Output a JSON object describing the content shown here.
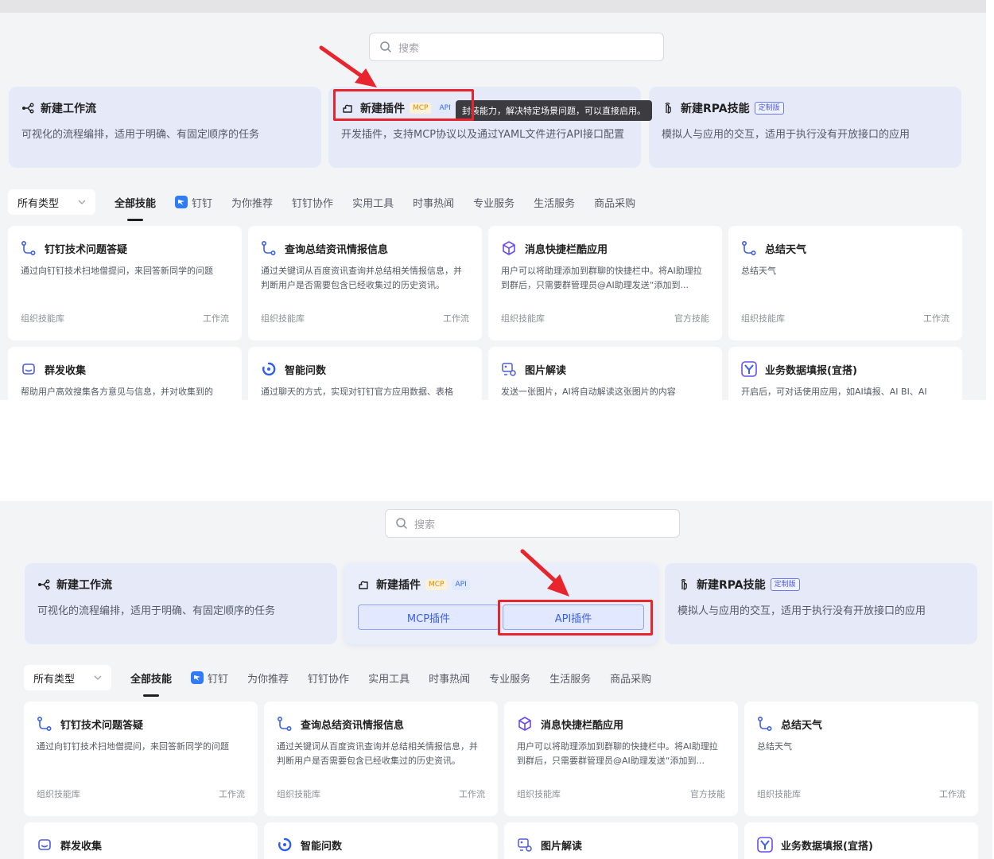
{
  "search": {
    "placeholder": "搜索"
  },
  "create_cards": {
    "workflow": {
      "title": "新建工作流",
      "desc": "可视化的流程编排，适用于明确、有固定顺序的任务"
    },
    "plugin": {
      "title": "新建插件",
      "tag_mcp": "MCP",
      "tag_api": "API",
      "desc": "开发插件，支持MCP协议以及通过YAML文件进行API接口配置"
    },
    "rpa": {
      "title": "新建RPA技能",
      "tag": "定制版",
      "desc": "模拟人与应用的交互，适用于执行没有开放接口的应用"
    }
  },
  "tooltip": "封装能力，解决特定场景问题，可以直接启用。",
  "plugin_buttons": {
    "mcp": "MCP插件",
    "api": "API插件"
  },
  "filter": {
    "type_select": "所有类型"
  },
  "tabs": [
    "全部技能",
    "钉钉",
    "为你推荐",
    "钉钉协作",
    "实用工具",
    "时事热闻",
    "专业服务",
    "生活服务",
    "商品采购"
  ],
  "skills_row1": [
    {
      "title": "钉钉技术问题答疑",
      "desc": "通过向钉钉技术扫地僧提问，来回答新同学的问题",
      "source": "组织技能库",
      "kind": "工作流",
      "icon": "workflow-icon"
    },
    {
      "title": "查询总结资讯情报信息",
      "desc": "通过关键词从百度资讯查询并总结相关情报信息，并判断用户是否需要包含已经收集过的历史资讯。",
      "source": "组织技能库",
      "kind": "工作流",
      "icon": "workflow-icon"
    },
    {
      "title": "消息快捷栏酷应用",
      "desc": "用户可以将助理添加到群聊的快捷栏中。将AI助理拉到群后，只需要群管理员@AI助理发送“添加到...",
      "source": "组织技能库",
      "kind": "官方技能",
      "icon": "cube-icon"
    },
    {
      "title": "总结天气",
      "desc": "总结天气",
      "source": "组织技能库",
      "kind": "工作流",
      "icon": "workflow-icon"
    }
  ],
  "skills_row2_top": [
    {
      "title": "群发收集",
      "desc": "帮助用户高效搜集各方意见与信息，并对收集到的"
    },
    {
      "title": "智能问数",
      "desc": "通过聊天的方式，实现对钉钉官方应用数据、表格"
    },
    {
      "title": "图片解读",
      "desc": "发送一张图片，AI将自动解读这张图片的内容"
    },
    {
      "title": "业务数据填报(宜搭)",
      "desc": "开启后，可对话使用应用，如AI填报、AI BI、AI"
    }
  ],
  "skills_row2_bottom": [
    {
      "title": "群发收集"
    },
    {
      "title": "智能问数"
    },
    {
      "title": "图片解读"
    },
    {
      "title": "业务数据填报(宜搭)"
    }
  ],
  "colors": {
    "accent": "#3a60e8",
    "highlight_red": "#e8242c",
    "card_bg": "#e6eaf8"
  }
}
